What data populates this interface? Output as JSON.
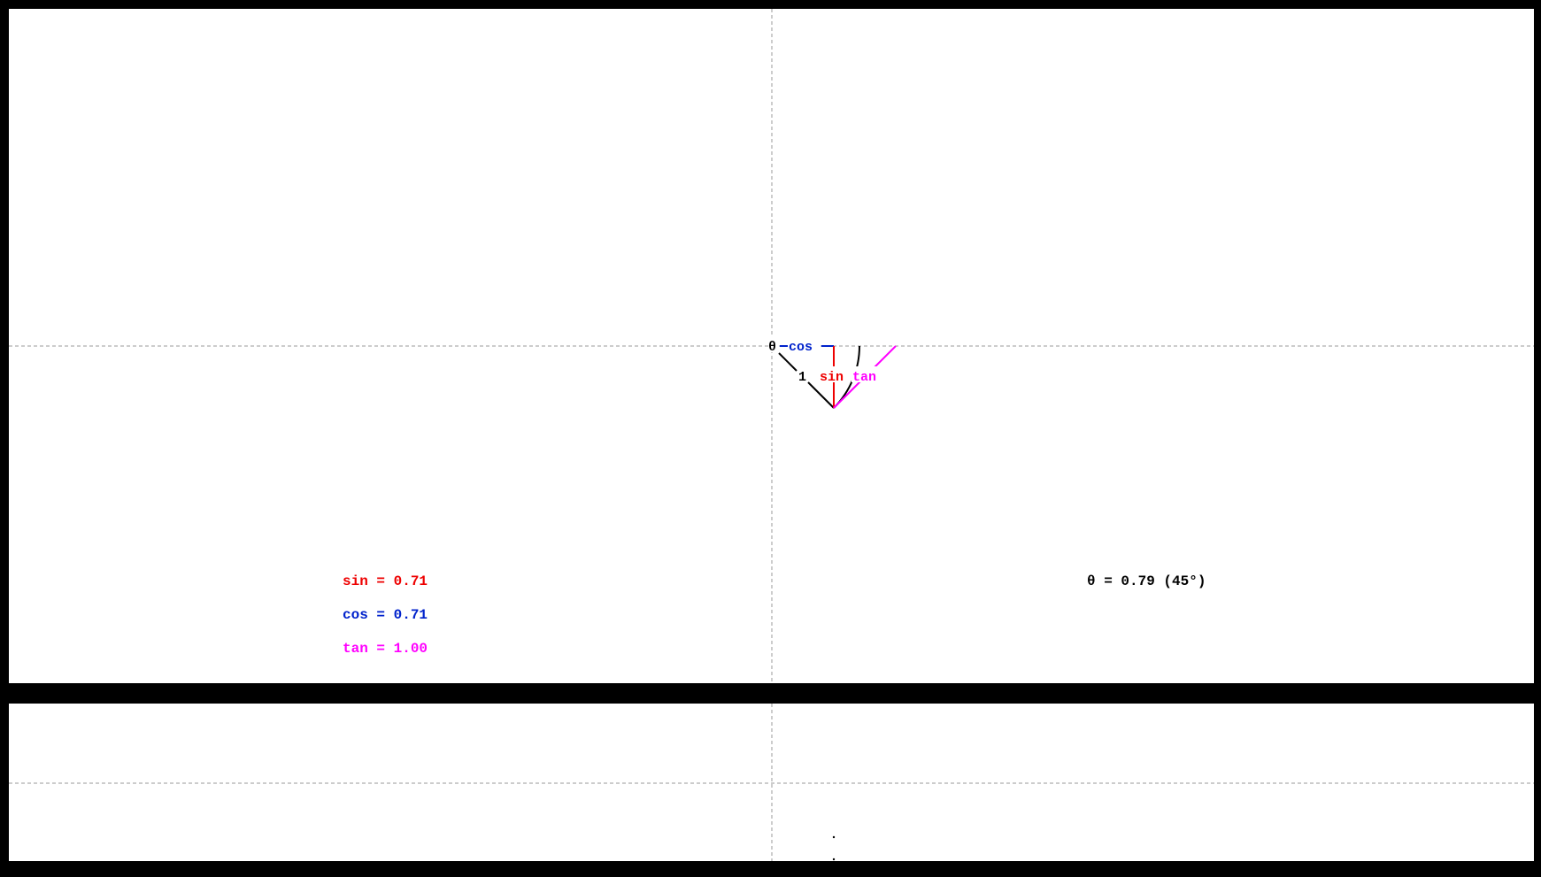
{
  "diagram": {
    "theta_rad": 0.785398,
    "labels": {
      "theta": "θ",
      "cos": "cos",
      "sin": "sin",
      "tan": "tan",
      "radius": "1"
    },
    "colors": {
      "sin": "#ee0000",
      "cos": "#0022cc",
      "tan": "#ff00ff",
      "radius": "#000000",
      "axis": "#999999"
    }
  },
  "readouts": {
    "sin": "sin = 0.71",
    "cos": "cos = 0.71",
    "tan": "tan = 1.00",
    "theta": "θ = 0.79 (45°)"
  }
}
